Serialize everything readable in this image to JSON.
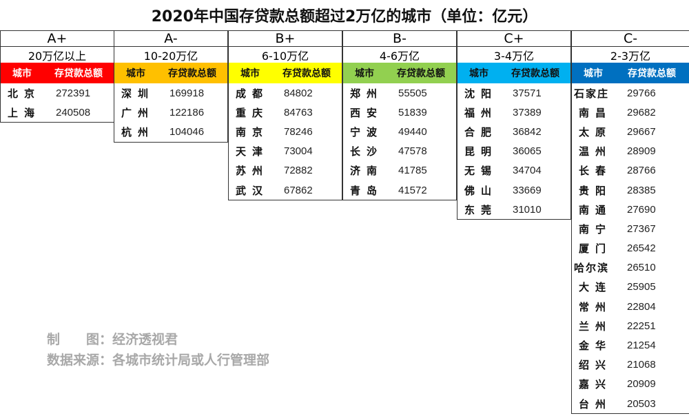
{
  "title": "2020年中国存贷款总额超过2万亿的城市（单位：亿元）",
  "header_city": "城市",
  "header_total": "存贷款总额",
  "groups": [
    {
      "grade": "A+",
      "range": "20万亿以上",
      "header_color": "#ff0000",
      "cities": [
        {
          "name": "北京",
          "value": "272391"
        },
        {
          "name": "上海",
          "value": "240508"
        }
      ]
    },
    {
      "grade": "A-",
      "range": "10-20万亿",
      "header_color": "#ffc000",
      "cities": [
        {
          "name": "深圳",
          "value": "169918"
        },
        {
          "name": "广州",
          "value": "122186"
        },
        {
          "name": "杭州",
          "value": "104046"
        }
      ]
    },
    {
      "grade": "B+",
      "range": "6-10万亿",
      "header_color": "#ffff00",
      "cities": [
        {
          "name": "成都",
          "value": "84802"
        },
        {
          "name": "重庆",
          "value": "84763"
        },
        {
          "name": "南京",
          "value": "78246"
        },
        {
          "name": "天津",
          "value": "73004"
        },
        {
          "name": "苏州",
          "value": "72882"
        },
        {
          "name": "武汉",
          "value": "67862"
        }
      ]
    },
    {
      "grade": "B-",
      "range": "4-6万亿",
      "header_color": "#92d050",
      "cities": [
        {
          "name": "郑州",
          "value": "55505"
        },
        {
          "name": "西安",
          "value": "51839"
        },
        {
          "name": "宁波",
          "value": "49440"
        },
        {
          "name": "长沙",
          "value": "47578"
        },
        {
          "name": "济南",
          "value": "41785"
        },
        {
          "name": "青岛",
          "value": "41572"
        }
      ]
    },
    {
      "grade": "C+",
      "range": "3-4万亿",
      "header_color": "#00b0f0",
      "cities": [
        {
          "name": "沈阳",
          "value": "37571"
        },
        {
          "name": "福州",
          "value": "37389"
        },
        {
          "name": "合肥",
          "value": "36842"
        },
        {
          "name": "昆明",
          "value": "36065"
        },
        {
          "name": "无锡",
          "value": "34704"
        },
        {
          "name": "佛山",
          "value": "33669"
        },
        {
          "name": "东莞",
          "value": "31010"
        }
      ]
    },
    {
      "grade": "C-",
      "range": "2-3万亿",
      "header_color": "#0070c0",
      "cities": [
        {
          "name": "石家庄",
          "value": "29766"
        },
        {
          "name": "南昌",
          "value": "29682"
        },
        {
          "name": "太原",
          "value": "29667"
        },
        {
          "name": "温州",
          "value": "28909"
        },
        {
          "name": "长春",
          "value": "28766"
        },
        {
          "name": "贵阳",
          "value": "28385"
        },
        {
          "name": "南通",
          "value": "27690"
        },
        {
          "name": "南宁",
          "value": "27367"
        },
        {
          "name": "厦门",
          "value": "26542"
        },
        {
          "name": "哈尔滨",
          "value": "26510"
        },
        {
          "name": "大连",
          "value": "25905"
        },
        {
          "name": "常州",
          "value": "22804"
        },
        {
          "name": "兰州",
          "value": "22251"
        },
        {
          "name": "金华",
          "value": "21254"
        },
        {
          "name": "绍兴",
          "value": "21068"
        },
        {
          "name": "嘉兴",
          "value": "20909"
        },
        {
          "name": "台州",
          "value": "20503"
        }
      ]
    }
  ],
  "credit_maker": "制　　图：经济透视君",
  "credit_source": "数据来源：各城市统计局或人行管理部"
}
